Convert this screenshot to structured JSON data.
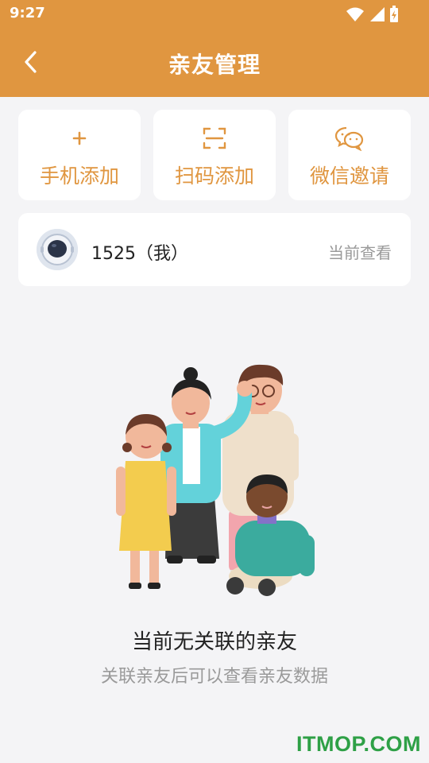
{
  "status_bar": {
    "time": "9:27"
  },
  "header": {
    "title": "亲友管理",
    "back_icon": "chevron-left-icon"
  },
  "actions": [
    {
      "label": "手机添加",
      "icon": "plus-icon"
    },
    {
      "label": "扫码添加",
      "icon": "scan-icon"
    },
    {
      "label": "微信邀请",
      "icon": "wechat-icon"
    }
  ],
  "current_user": {
    "name": "1525（我）",
    "status": "当前查看",
    "avatar": "astronaut-avatar"
  },
  "empty_state": {
    "title": "当前无关联的亲友",
    "subtitle": "关联亲友后可以查看亲友数据",
    "illustration": "family-illustration"
  },
  "watermark": "ITMOP.COM",
  "colors": {
    "accent": "#e09640",
    "background": "#f4f4f6",
    "watermark": "#2ea046"
  }
}
